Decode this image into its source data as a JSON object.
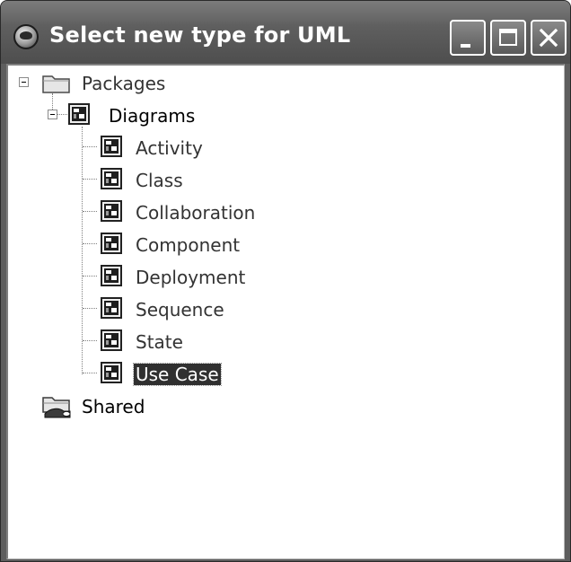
{
  "window": {
    "title": "Select new type for UML"
  },
  "tree": {
    "root": {
      "label": "Packages",
      "icon": "folder-icon"
    },
    "diagrams": {
      "label": "Diagrams",
      "icon": "diagram-icon"
    },
    "items": [
      {
        "label": "Activity",
        "icon": "diagram-icon"
      },
      {
        "label": "Class",
        "icon": "diagram-icon"
      },
      {
        "label": "Collaboration",
        "icon": "diagram-icon"
      },
      {
        "label": "Component",
        "icon": "diagram-icon"
      },
      {
        "label": "Deployment",
        "icon": "diagram-icon"
      },
      {
        "label": "Sequence",
        "icon": "diagram-icon"
      },
      {
        "label": "State",
        "icon": "diagram-icon"
      },
      {
        "label": "Use Case",
        "icon": "diagram-icon"
      }
    ],
    "shared": {
      "label": "Shared",
      "icon": "shared-folder-icon"
    },
    "selected": "Use Case"
  }
}
